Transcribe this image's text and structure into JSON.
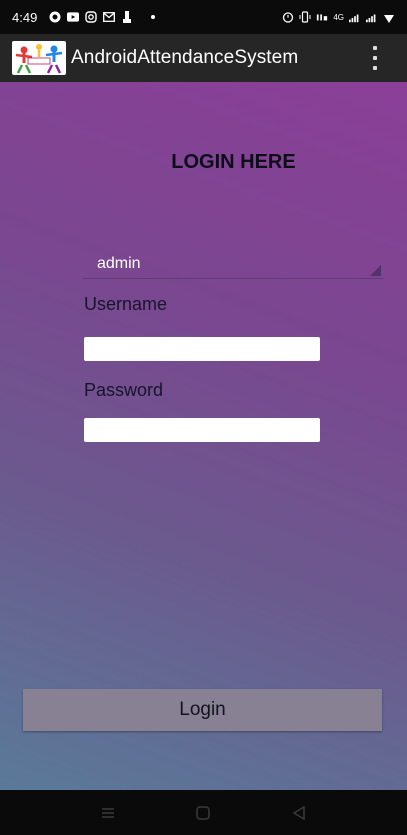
{
  "status_bar": {
    "time": "4:49",
    "left_icons": [
      "whatsapp-icon",
      "youtube-icon",
      "instagram-icon",
      "gmail-icon",
      "notification-icon"
    ],
    "right_icons": [
      "alarm-icon",
      "vibrate-icon",
      "volte-icon",
      "signal-4g-icon",
      "signal-icon",
      "wifi-icon"
    ],
    "network_text": "4G"
  },
  "app_bar": {
    "title": "AndroidAttendanceSystem",
    "logo_icon": "app-logo-icon",
    "menu_icon": "overflow-menu-icon"
  },
  "login": {
    "heading": "LOGIN HERE",
    "role_select": {
      "selected": "admin",
      "arrow_icon": "dropdown-triangle-icon"
    },
    "username_label": "Username",
    "username_value": "",
    "password_label": "Password",
    "password_value": "",
    "login_button": "Login"
  },
  "nav_bar": {
    "icons": [
      "recent-apps-icon",
      "home-icon",
      "back-icon"
    ]
  },
  "colors": {
    "gradient_top": "#8b3f98",
    "gradient_bottom": "#5a7a99",
    "app_bar_bg": "#262626",
    "button_bg": "#878193"
  }
}
